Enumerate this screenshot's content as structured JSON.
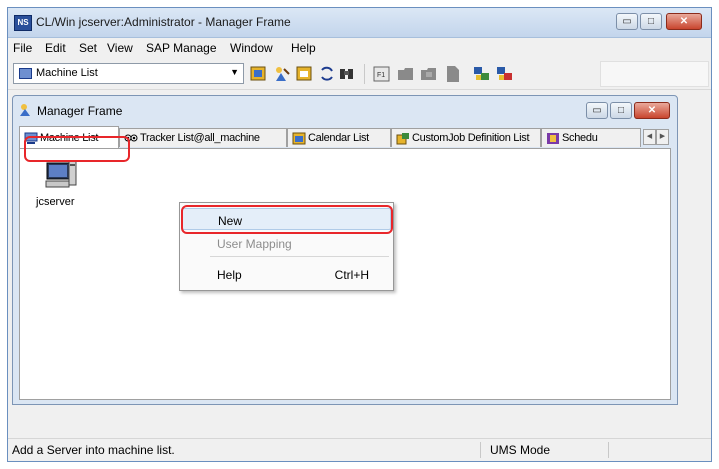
{
  "window": {
    "app_icon_text": "NS",
    "title": "CL/Win jcserver:Administrator - Manager Frame",
    "minimize_glyph": "▭",
    "maximize_glyph": "□",
    "close_glyph": "✕"
  },
  "menubar": {
    "items": [
      "File",
      "Edit",
      "Set",
      "View",
      "SAP Manage",
      "Window",
      "Help"
    ]
  },
  "toolbar": {
    "combo_value": "Machine List",
    "combo_arrow": "▼"
  },
  "child_window": {
    "title": "Manager Frame",
    "tabs": [
      "Machine List",
      "Tracker List@all_machine",
      "Calendar List",
      "CustomJob Definition List",
      "Schedu"
    ],
    "scroll_left": "◀",
    "scroll_right": "▶"
  },
  "content": {
    "machine_label": "jcserver"
  },
  "context_menu": {
    "items": [
      {
        "label": "New",
        "shortcut": "",
        "disabled": false
      },
      {
        "label": "User Mapping",
        "shortcut": "",
        "disabled": true
      },
      {
        "label": "Help",
        "shortcut": "Ctrl+H",
        "disabled": false
      }
    ]
  },
  "statusbar": {
    "message": "Add a Server into machine list.",
    "mode": "UMS Mode"
  },
  "colors": {
    "highlight": "#e8262a",
    "title_gradient_top": "#dbe7f5"
  }
}
